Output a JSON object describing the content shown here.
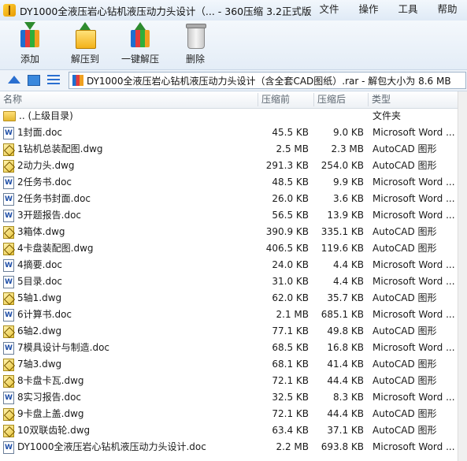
{
  "window": {
    "title": "DY1000全液压岩心钻机液压动力头设计（... - 360压缩 3.2正式版",
    "menu": [
      "文件",
      "操作",
      "工具",
      "帮助"
    ]
  },
  "toolbar": {
    "buttons": [
      {
        "label": "添加",
        "icon": "add-archive-icon"
      },
      {
        "label": "解压到",
        "icon": "extract-to-icon"
      },
      {
        "label": "一键解压",
        "icon": "one-click-extract-icon"
      },
      {
        "label": "删除",
        "icon": "delete-icon"
      }
    ]
  },
  "address": {
    "path": "DY1000全液压岩心钻机液压动力头设计（含全套CAD图纸）.rar - 解包大小为 8.6 MB"
  },
  "columns": {
    "name": "名称",
    "before": "压缩前",
    "after": "压缩后",
    "type": "类型"
  },
  "files": [
    {
      "icon": "folder-icon",
      "name": ".. (上级目录)",
      "before": "",
      "after": "",
      "type": "文件夹"
    },
    {
      "icon": "word-doc-icon",
      "name": "1封面.doc",
      "before": "45.5 KB",
      "after": "9.0 KB",
      "type": "Microsoft Word ..."
    },
    {
      "icon": "dwg-file-icon",
      "name": "1钻机总装配图.dwg",
      "before": "2.5 MB",
      "after": "2.3 MB",
      "type": "AutoCAD 图形"
    },
    {
      "icon": "dwg-file-icon",
      "name": "2动力头.dwg",
      "before": "291.3 KB",
      "after": "254.0 KB",
      "type": "AutoCAD 图形"
    },
    {
      "icon": "word-doc-icon",
      "name": "2任务书.doc",
      "before": "48.5 KB",
      "after": "9.9 KB",
      "type": "Microsoft Word ..."
    },
    {
      "icon": "word-doc-icon",
      "name": "2任务书封面.doc",
      "before": "26.0 KB",
      "after": "3.6 KB",
      "type": "Microsoft Word ..."
    },
    {
      "icon": "word-doc-icon",
      "name": "3开题报告.doc",
      "before": "56.5 KB",
      "after": "13.9 KB",
      "type": "Microsoft Word ..."
    },
    {
      "icon": "dwg-file-icon",
      "name": "3箱体.dwg",
      "before": "390.9 KB",
      "after": "335.1 KB",
      "type": "AutoCAD 图形"
    },
    {
      "icon": "dwg-file-icon",
      "name": "4卡盘装配图.dwg",
      "before": "406.5 KB",
      "after": "119.6 KB",
      "type": "AutoCAD 图形"
    },
    {
      "icon": "word-doc-icon",
      "name": "4摘要.doc",
      "before": "24.0 KB",
      "after": "4.4 KB",
      "type": "Microsoft Word ..."
    },
    {
      "icon": "word-doc-icon",
      "name": "5目录.doc",
      "before": "31.0 KB",
      "after": "4.4 KB",
      "type": "Microsoft Word ..."
    },
    {
      "icon": "dwg-file-icon",
      "name": "5轴1.dwg",
      "before": "62.0 KB",
      "after": "35.7 KB",
      "type": "AutoCAD 图形"
    },
    {
      "icon": "word-doc-icon",
      "name": "6计算书.doc",
      "before": "2.1 MB",
      "after": "685.1 KB",
      "type": "Microsoft Word ..."
    },
    {
      "icon": "dwg-file-icon",
      "name": "6轴2.dwg",
      "before": "77.1 KB",
      "after": "49.8 KB",
      "type": "AutoCAD 图形"
    },
    {
      "icon": "word-doc-icon",
      "name": "7模具设计与制造.doc",
      "before": "68.5 KB",
      "after": "16.8 KB",
      "type": "Microsoft Word ..."
    },
    {
      "icon": "dwg-file-icon",
      "name": "7轴3.dwg",
      "before": "68.1 KB",
      "after": "41.4 KB",
      "type": "AutoCAD 图形"
    },
    {
      "icon": "dwg-file-icon",
      "name": "8卡盘卡瓦.dwg",
      "before": "72.1 KB",
      "after": "44.4 KB",
      "type": "AutoCAD 图形"
    },
    {
      "icon": "word-doc-icon",
      "name": "8实习报告.doc",
      "before": "32.5 KB",
      "after": "8.3 KB",
      "type": "Microsoft Word ..."
    },
    {
      "icon": "dwg-file-icon",
      "name": "9卡盘上盖.dwg",
      "before": "72.1 KB",
      "after": "44.4 KB",
      "type": "AutoCAD 图形"
    },
    {
      "icon": "dwg-file-icon",
      "name": "10双联齿轮.dwg",
      "before": "63.4 KB",
      "after": "37.1 KB",
      "type": "AutoCAD 图形"
    },
    {
      "icon": "word-doc-icon",
      "name": "DY1000全液压岩心钻机液压动力头设计.doc",
      "before": "2.2 MB",
      "after": "693.8 KB",
      "type": "Microsoft Word ..."
    }
  ]
}
